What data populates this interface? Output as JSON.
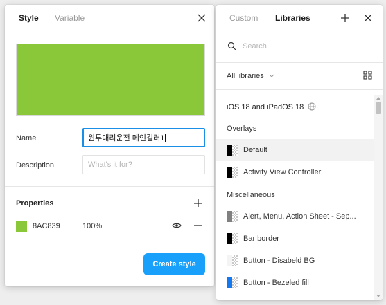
{
  "style_panel": {
    "tabs": [
      {
        "label": "Style",
        "active": true
      },
      {
        "label": "Variable",
        "active": false
      }
    ],
    "color_hex": "#8AC839",
    "name_label": "Name",
    "name_value": "윈투대리운전 메인컬러1",
    "description_label": "Description",
    "description_placeholder": "What's it for?",
    "properties_title": "Properties",
    "property": {
      "hex": "8AC839",
      "opacity": "100%",
      "color": "#8AC839"
    },
    "create_button": "Create style",
    "accent_color": "#18A0FB"
  },
  "library_panel": {
    "tabs": [
      {
        "label": "Custom",
        "active": false
      },
      {
        "label": "Libraries",
        "active": true
      }
    ],
    "search_placeholder": "Search",
    "filter_label": "All libraries",
    "library_name": "iOS 18 and iPadOS 18",
    "sections": [
      {
        "label": "Overlays",
        "items": [
          {
            "label": "Default",
            "swatch": "#000000",
            "selected": true
          },
          {
            "label": "Activity View Controller",
            "swatch": "#000000",
            "selected": false
          }
        ]
      },
      {
        "label": "Miscellaneous",
        "items": [
          {
            "label": "Alert, Menu, Action Sheet - Sep...",
            "swatch": "#808080",
            "selected": false
          },
          {
            "label": "Bar border",
            "swatch": "#000000",
            "selected": false
          },
          {
            "label": "Button - Disabeld BG",
            "swatch": "#f4f4f4",
            "selected": false
          },
          {
            "label": "Button - Bezeled fill",
            "swatch": "#1478f0",
            "selected": false
          }
        ]
      }
    ],
    "icons": [
      "search-icon",
      "chevron-down-icon",
      "grid-view-icon",
      "globe-icon",
      "add-icon",
      "close-icon"
    ]
  }
}
